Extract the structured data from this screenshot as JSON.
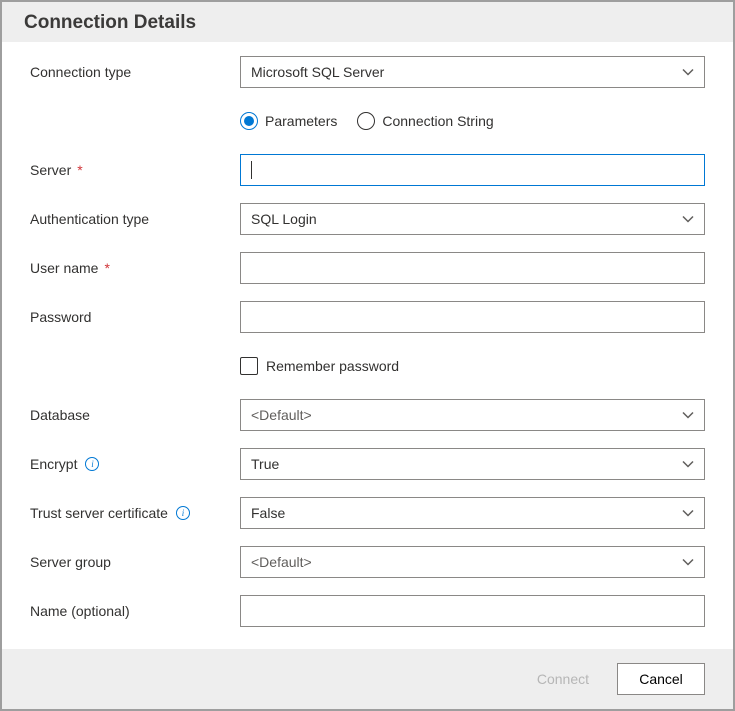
{
  "header": {
    "title": "Connection Details"
  },
  "fields": {
    "connection_type": {
      "label": "Connection type",
      "value": "Microsoft SQL Server"
    },
    "input_mode": {
      "options": {
        "parameters": "Parameters",
        "connection_string": "Connection String"
      },
      "selected": "parameters"
    },
    "server": {
      "label": "Server",
      "value": ""
    },
    "auth_type": {
      "label": "Authentication type",
      "value": "SQL Login"
    },
    "user_name": {
      "label": "User name",
      "value": ""
    },
    "password": {
      "label": "Password",
      "value": ""
    },
    "remember_password": {
      "label": "Remember password",
      "checked": false
    },
    "database": {
      "label": "Database",
      "value": "<Default>"
    },
    "encrypt": {
      "label": "Encrypt",
      "value": "True"
    },
    "trust_cert": {
      "label": "Trust server certificate",
      "value": "False"
    },
    "server_group": {
      "label": "Server group",
      "value": "<Default>"
    },
    "name": {
      "label": "Name (optional)",
      "value": ""
    }
  },
  "buttons": {
    "connect": "Connect",
    "cancel": "Cancel"
  }
}
